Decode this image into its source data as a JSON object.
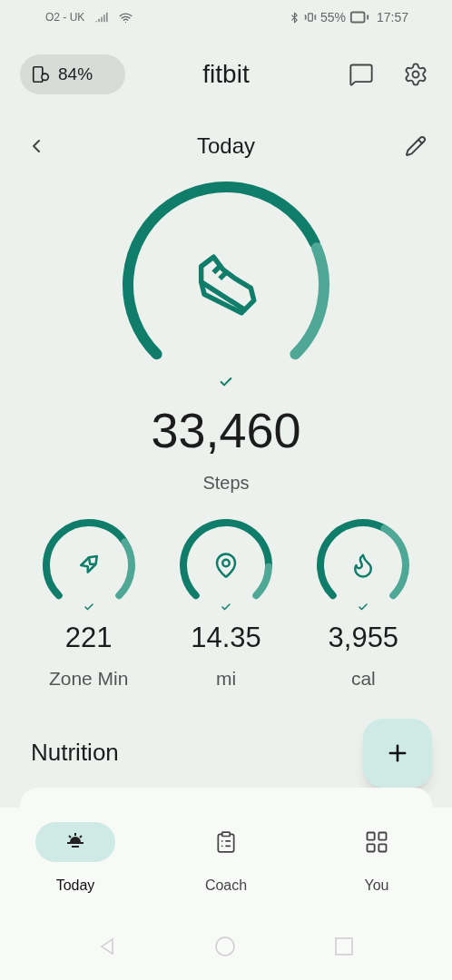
{
  "status_bar": {
    "carrier": "O2 - UK",
    "battery": "55%",
    "time": "17:57"
  },
  "header": {
    "device_battery": "84%",
    "title": "fitbit"
  },
  "date_nav": {
    "title": "Today"
  },
  "main_stat": {
    "kind": "steps",
    "value": "33,460",
    "label": "Steps",
    "goal_met": true
  },
  "stats": [
    {
      "kind": "zone",
      "value": "221",
      "label": "Zone Min",
      "goal_met": true
    },
    {
      "kind": "distance",
      "value": "14.35",
      "label": "mi",
      "goal_met": true
    },
    {
      "kind": "calories",
      "value": "3,955",
      "label": "cal",
      "goal_met": true
    }
  ],
  "section": {
    "title": "Nutrition"
  },
  "nav": [
    {
      "kind": "today",
      "label": "Today",
      "selected": true
    },
    {
      "kind": "coach",
      "label": "Coach",
      "selected": false
    },
    {
      "kind": "you",
      "label": "You",
      "selected": false
    }
  ]
}
